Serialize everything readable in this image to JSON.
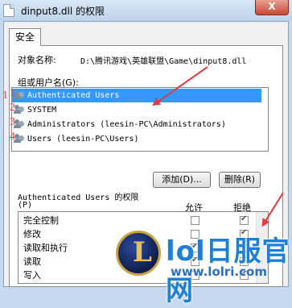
{
  "window": {
    "title": "dinput8.dll 的权限",
    "close_glyph": "X"
  },
  "tab": {
    "label": "安全"
  },
  "object": {
    "label": "对象名称:",
    "path": "D:\\腾讯游戏\\英雄联盟\\Game\\dinput8.dll"
  },
  "groups": {
    "label": "组或用户名(G):",
    "items": [
      {
        "num": "1",
        "name": "Authenticated Users",
        "selected": true
      },
      {
        "num": "2",
        "name": "SYSTEM",
        "selected": false
      },
      {
        "num": "3",
        "name": "Administrators (leesin-PC\\Administrators)",
        "selected": false
      },
      {
        "num": "4",
        "name": "Users (leesin-PC\\Users)",
        "selected": false
      }
    ]
  },
  "buttons": {
    "add": "添加(D)...",
    "remove": "删除(R)"
  },
  "permissions": {
    "header": "Authenticated Users 的权限",
    "header_p": "(P)",
    "allow_label": "允许",
    "deny_label": "拒绝",
    "rows": [
      {
        "name": "完全控制",
        "allow": false,
        "deny": true
      },
      {
        "name": "修改",
        "allow": false,
        "deny": true
      },
      {
        "name": "读取和执行",
        "allow": true,
        "deny": false
      },
      {
        "name": "读取",
        "allow": true,
        "deny": false
      },
      {
        "name": "写入",
        "allow": false,
        "deny": true
      }
    ]
  },
  "watermark": {
    "logo_letter": "L",
    "title": "lol日服官网",
    "url": "www.lolri.com"
  },
  "colors": {
    "selection": "#3399ff",
    "annotation": "#e0393e"
  }
}
